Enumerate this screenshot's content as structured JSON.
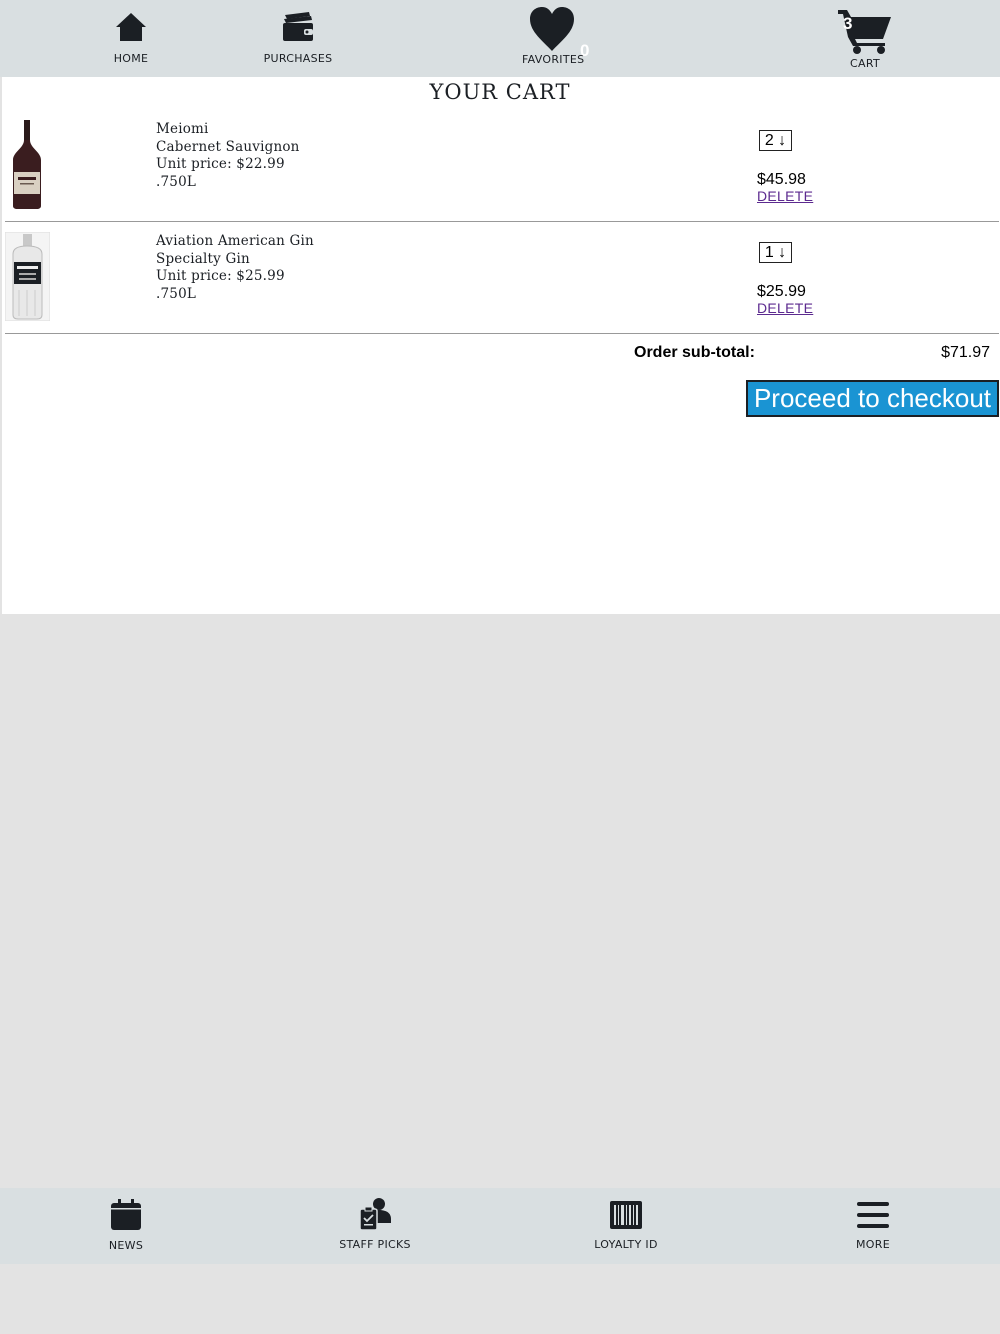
{
  "top_nav": {
    "home": "HOME",
    "purchases": "PURCHASES",
    "favorites": "FAVORITES",
    "favorites_count": "0",
    "cart": "CART",
    "cart_count": "3"
  },
  "cart": {
    "title": "YOUR CART",
    "items": [
      {
        "brand": "Meiomi",
        "type": "Cabernet Sauvignon",
        "unit_price": "Unit price: $22.99",
        "size": ".750L",
        "qty": "2 ↓",
        "total": "$45.98",
        "delete": "DELETE"
      },
      {
        "brand": "Aviation American Gin",
        "type": "Specialty Gin",
        "unit_price": "Unit price: $25.99",
        "size": ".750L",
        "qty": "1 ↓",
        "total": "$25.99",
        "delete": "DELETE"
      }
    ],
    "subtotal_label": "Order sub-total:",
    "subtotal_value": "$71.97",
    "checkout_label": "Proceed to checkout"
  },
  "bottom_nav": {
    "news": "NEWS",
    "staff_picks": "STAFF PICKS",
    "loyalty_id": "LOYALTY ID",
    "more": "MORE"
  },
  "colors": {
    "nav_bg": "#d9dfe1",
    "page_bg": "#e3e3e3",
    "checkout_bg": "#1a94d3",
    "link": "#5c2a8f"
  }
}
